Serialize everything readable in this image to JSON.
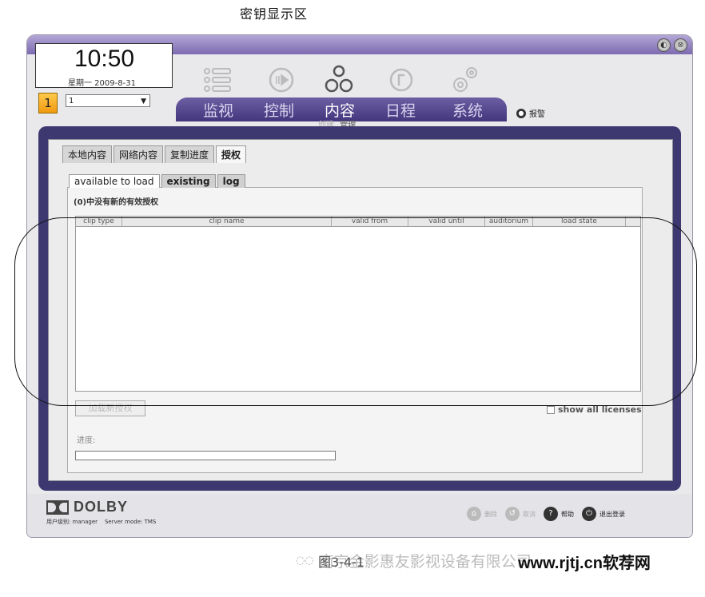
{
  "annotation": {
    "title": "密钥显示区"
  },
  "window": {
    "controls": [
      "◐",
      "⊗"
    ]
  },
  "clock": {
    "time": "10:50",
    "date": "星期一 2009-8-31"
  },
  "channel": {
    "number": "1",
    "selected": "1"
  },
  "nav": {
    "tabs": [
      "监视",
      "控制",
      "内容",
      "日程",
      "系统"
    ],
    "active_tab": "内容",
    "subnav": {
      "muted": "创建",
      "item": "管理"
    },
    "alert_label": "报警"
  },
  "content_tabs": [
    "本地内容",
    "网络内容",
    "复制进度",
    "授权"
  ],
  "sub_tabs": [
    "available to load",
    "existing",
    "log"
  ],
  "notice": "(0)中没有新的有效授权",
  "table": {
    "columns": [
      "clip type",
      "clip name",
      "valid from",
      "valid until",
      "auditorium",
      "load state"
    ],
    "rows": []
  },
  "load_button": "加载新授权",
  "show_all_label": "show all licenses",
  "progress": {
    "label": "进度:",
    "value": 0
  },
  "footer": {
    "brand": "DOLBY",
    "user_prefix": "用户级别:",
    "user_name": "manager",
    "server_mode": "Server mode: TMS",
    "buttons": [
      {
        "label": "删除",
        "dim": true
      },
      {
        "label": "取消",
        "dim": true
      },
      {
        "label": "帮助",
        "dim": false
      },
      {
        "label": "退出登录",
        "dim": false
      }
    ]
  },
  "caption": "图3-4-1",
  "watermark": {
    "icon": "wechat-icon",
    "text": "南京金影惠友影视设备有限公司",
    "url": "www.rjtj.cn软荐网"
  },
  "colors": {
    "accent": "#43367d",
    "nav_bar": "#6e5fa3",
    "channel": "#f09a10"
  }
}
